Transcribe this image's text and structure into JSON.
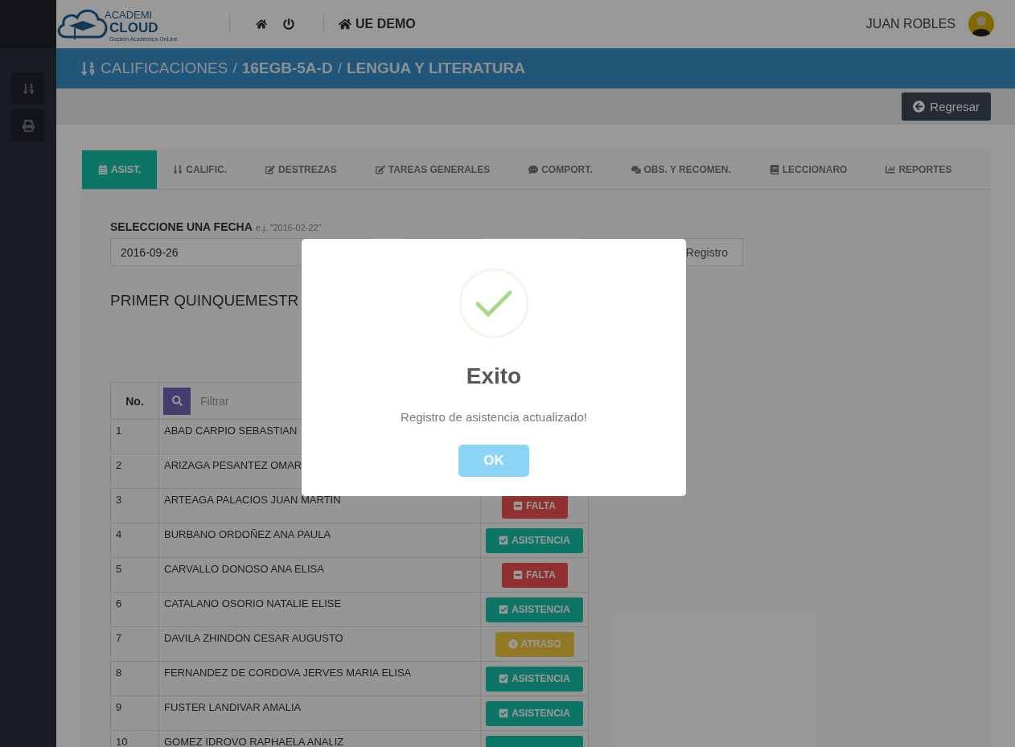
{
  "top_bar": {
    "logo": {
      "line_1": "ACADEMI",
      "line_2": "CLOUD",
      "tagline": "Gestión Académica OnLine"
    },
    "institution": "UE DEMO",
    "user": "JUAN ROBLES"
  },
  "breadcrumb": {
    "separator": "/",
    "items": [
      {
        "text": "CALIFICACIONES",
        "bold": false
      },
      {
        "text": "16EGB-5A-D",
        "bold": true
      },
      {
        "text": "LENGUA Y LITERATURA",
        "bold": true
      }
    ]
  },
  "back_button": "Regresar",
  "tabs": [
    {
      "label": "ASIST.",
      "selected": true
    },
    {
      "label": "CALIFIC.",
      "selected": false
    },
    {
      "label": "DESTREZAS",
      "selected": false
    },
    {
      "label": "TAREAS GENERALES",
      "selected": false
    },
    {
      "label": "COMPORT.",
      "selected": false
    },
    {
      "label": "OBS. Y RECOMEN.",
      "selected": false
    },
    {
      "label": "LECCIONARO",
      "selected": false
    },
    {
      "label": "REPORTES",
      "selected": false
    }
  ],
  "date_picker": {
    "label": "SELECCIONE UNA FECHA",
    "hint": "e.j. \"2016-02-22\"",
    "value": "2016-09-26"
  },
  "register_button": "Registro",
  "period_title": "PRIMER QUINQUEMESTR",
  "table": {
    "columns": [
      "No."
    ],
    "filter_placeholder": "Filtrar",
    "rows": [
      {
        "number": "1",
        "name": "ABAD CARPIO SEBASTIAN"
      },
      {
        "number": "2",
        "name": "ARIZAGA PESANTEZ OMAR"
      },
      {
        "number": "3",
        "name": "ARTEAGA PALACIOS JUAN MARTIN",
        "status": {
          "kind": "falta",
          "label": "FALTA"
        }
      },
      {
        "number": "4",
        "name": "BURBANO ORDOÑEZ ANA PAULA",
        "status": {
          "kind": "asistencia",
          "label": "ASISTENCIA"
        }
      },
      {
        "number": "5",
        "name": "CARVALLO DONOSO ANA ELISA",
        "status": {
          "kind": "falta",
          "label": "FALTA"
        }
      },
      {
        "number": "6",
        "name": "CATALANO OSORIO NATALIE ELISE",
        "status": {
          "kind": "asistencia",
          "label": "ASISTENCIA"
        }
      },
      {
        "number": "7",
        "name": "DAVILA ZHINDON CESAR AUGUSTO",
        "status": {
          "kind": "atraso",
          "label": "ATRASO"
        }
      },
      {
        "number": "8",
        "name": "FERNANDEZ DE CORDOVA JERVES MARIA ELISA",
        "status": {
          "kind": "asistencia",
          "label": "ASISTENCIA"
        }
      },
      {
        "number": "9",
        "name": "FUSTER LANDIVAR AMALIA",
        "status": {
          "kind": "asistencia",
          "label": "ASISTENCIA"
        }
      },
      {
        "number": "10",
        "name": "GOMEZ IDROVO RAPHAELA ANALIZ",
        "status": {
          "kind": "asistencia"
        }
      }
    ]
  },
  "dialog": {
    "title": "Exito",
    "message": "Registro de asistencia actualizado!",
    "button": "OK"
  }
}
